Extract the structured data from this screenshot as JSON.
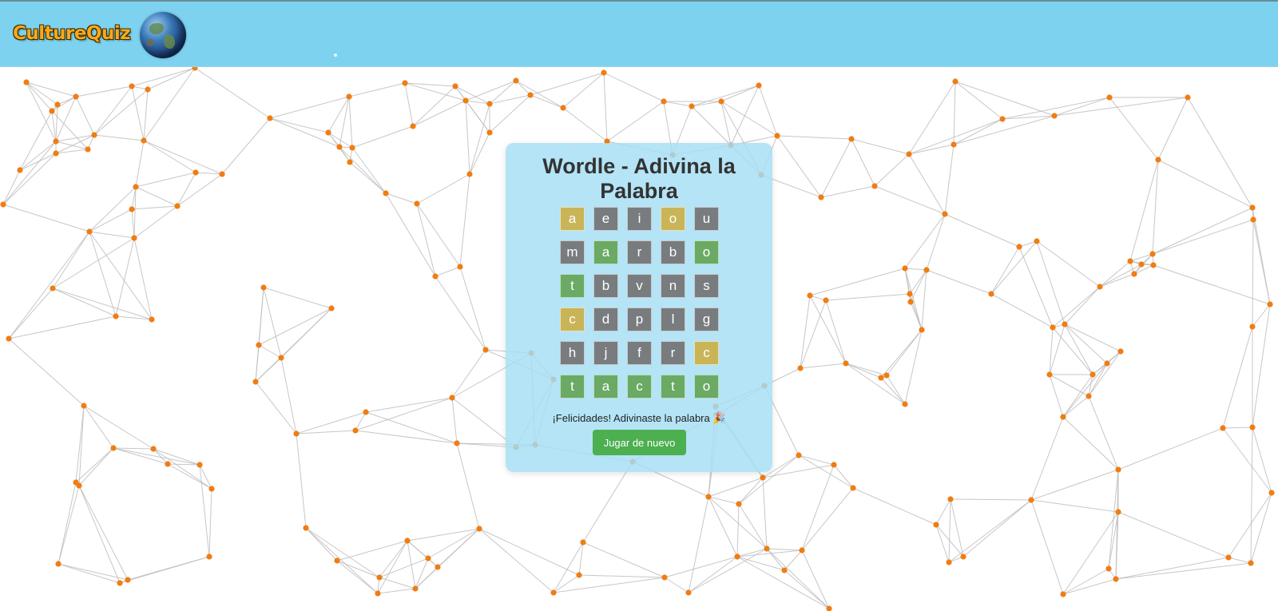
{
  "header": {
    "logo_text": "CultureQuiz",
    "globe_icon": "globe-icon",
    "background_color": "#7dd3ef",
    "logo_color": "#f7a81b"
  },
  "game": {
    "title": "Wordle - Adivina la Palabra",
    "rows": [
      [
        {
          "letter": "a",
          "state": "present"
        },
        {
          "letter": "e",
          "state": "absent"
        },
        {
          "letter": "i",
          "state": "absent"
        },
        {
          "letter": "o",
          "state": "present"
        },
        {
          "letter": "u",
          "state": "absent"
        }
      ],
      [
        {
          "letter": "m",
          "state": "absent"
        },
        {
          "letter": "a",
          "state": "correct"
        },
        {
          "letter": "r",
          "state": "absent"
        },
        {
          "letter": "b",
          "state": "absent"
        },
        {
          "letter": "o",
          "state": "correct"
        }
      ],
      [
        {
          "letter": "t",
          "state": "correct"
        },
        {
          "letter": "b",
          "state": "absent"
        },
        {
          "letter": "v",
          "state": "absent"
        },
        {
          "letter": "n",
          "state": "absent"
        },
        {
          "letter": "s",
          "state": "absent"
        }
      ],
      [
        {
          "letter": "c",
          "state": "present"
        },
        {
          "letter": "d",
          "state": "absent"
        },
        {
          "letter": "p",
          "state": "absent"
        },
        {
          "letter": "l",
          "state": "absent"
        },
        {
          "letter": "g",
          "state": "absent"
        }
      ],
      [
        {
          "letter": "h",
          "state": "absent"
        },
        {
          "letter": "j",
          "state": "absent"
        },
        {
          "letter": "f",
          "state": "absent"
        },
        {
          "letter": "r",
          "state": "absent"
        },
        {
          "letter": "c",
          "state": "present"
        }
      ],
      [
        {
          "letter": "t",
          "state": "correct"
        },
        {
          "letter": "a",
          "state": "correct"
        },
        {
          "letter": "c",
          "state": "correct"
        },
        {
          "letter": "t",
          "state": "correct"
        },
        {
          "letter": "o",
          "state": "correct"
        }
      ]
    ],
    "message": "¡Felicidades! Adivinaste la palabra 🎉",
    "play_again_label": "Jugar de nuevo",
    "colors": {
      "correct": "#6aaa64",
      "present": "#c9b458",
      "absent": "#787c7e",
      "button": "#4caf50"
    }
  },
  "background": {
    "node_color": "#f07d12",
    "edge_color": "#bdbdbd"
  }
}
